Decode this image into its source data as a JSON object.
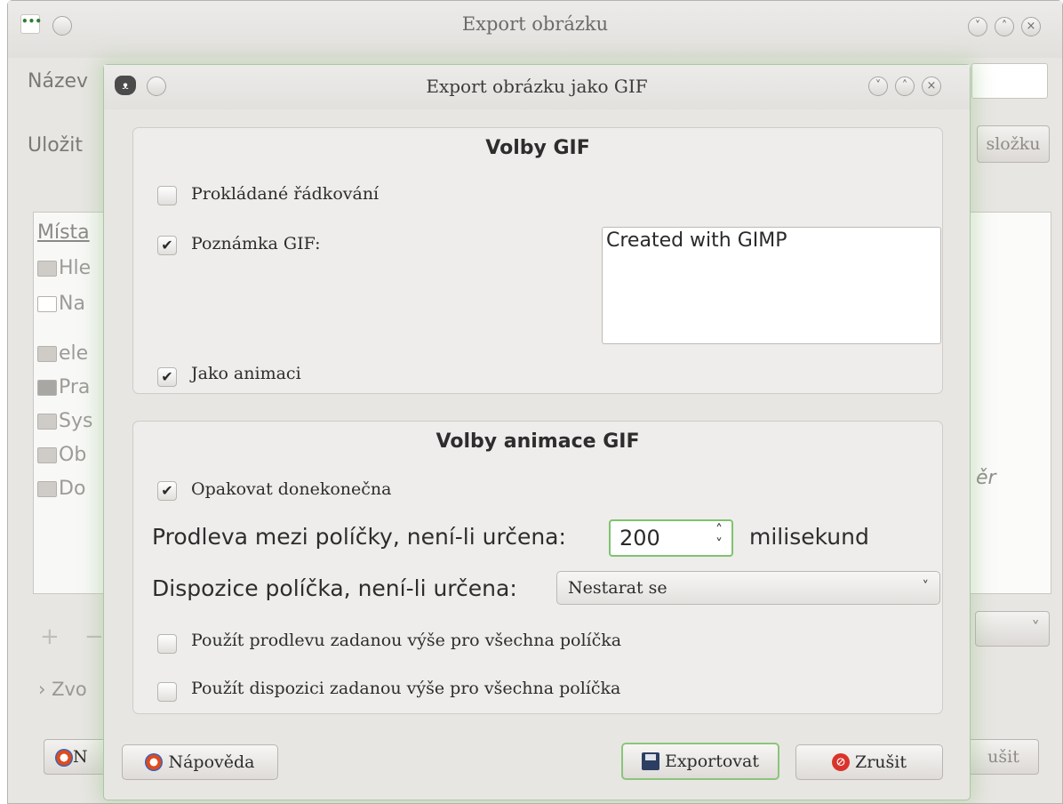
{
  "back_window": {
    "title": "Export obrázku",
    "name_label": "Název",
    "save_label": "Uložit",
    "create_folder_button": "složku",
    "places_header": "Místa",
    "places": [
      {
        "label": "Hle",
        "icon": "binoculars-icon"
      },
      {
        "label": "Na",
        "icon": "recent-icon"
      },
      {
        "label": "ele",
        "icon": "home-folder-icon"
      },
      {
        "label": "Pra",
        "icon": "desktop-icon"
      },
      {
        "label": "Sys",
        "icon": "drive-icon"
      },
      {
        "label": "Ob",
        "icon": "folder-icon"
      },
      {
        "label": "Do",
        "icon": "folder-icon"
      }
    ],
    "files_text": "ěr",
    "expander_label": "Zvo",
    "help_button": "N",
    "cancel_button": "ušit"
  },
  "dialog": {
    "title": "Export obrázku jako GIF",
    "gif_options": {
      "title": "Volby GIF",
      "interlace_label": "Prokládané řádkování",
      "interlace_checked": false,
      "comment_label": "Poznámka GIF:",
      "comment_checked": true,
      "comment_text": "Created with GIMP",
      "animation_label": "Jako animaci",
      "animation_checked": true
    },
    "animation_options": {
      "title": "Volby animace GIF",
      "loop_label": "Opakovat donekonečna",
      "loop_checked": true,
      "delay_label": "Prodleva mezi políčky, není-li určena:",
      "delay_value": "200",
      "delay_unit": "milisekund",
      "disposal_label": "Dispozice políčka, není-li určena:",
      "disposal_value": "Nestarat se",
      "use_delay_all_label": "Použít prodlevu zadanou výše pro všechna políčka",
      "use_delay_all_checked": false,
      "use_disposal_all_label": "Použít dispozici zadanou výše pro všechna políčka",
      "use_disposal_all_checked": false
    },
    "buttons": {
      "help": "Nápověda",
      "export": "Exportovat",
      "cancel": "Zrušit"
    }
  },
  "colors": {
    "focus_green": "#7fc36e",
    "window_bg": "#e8e6e3"
  }
}
